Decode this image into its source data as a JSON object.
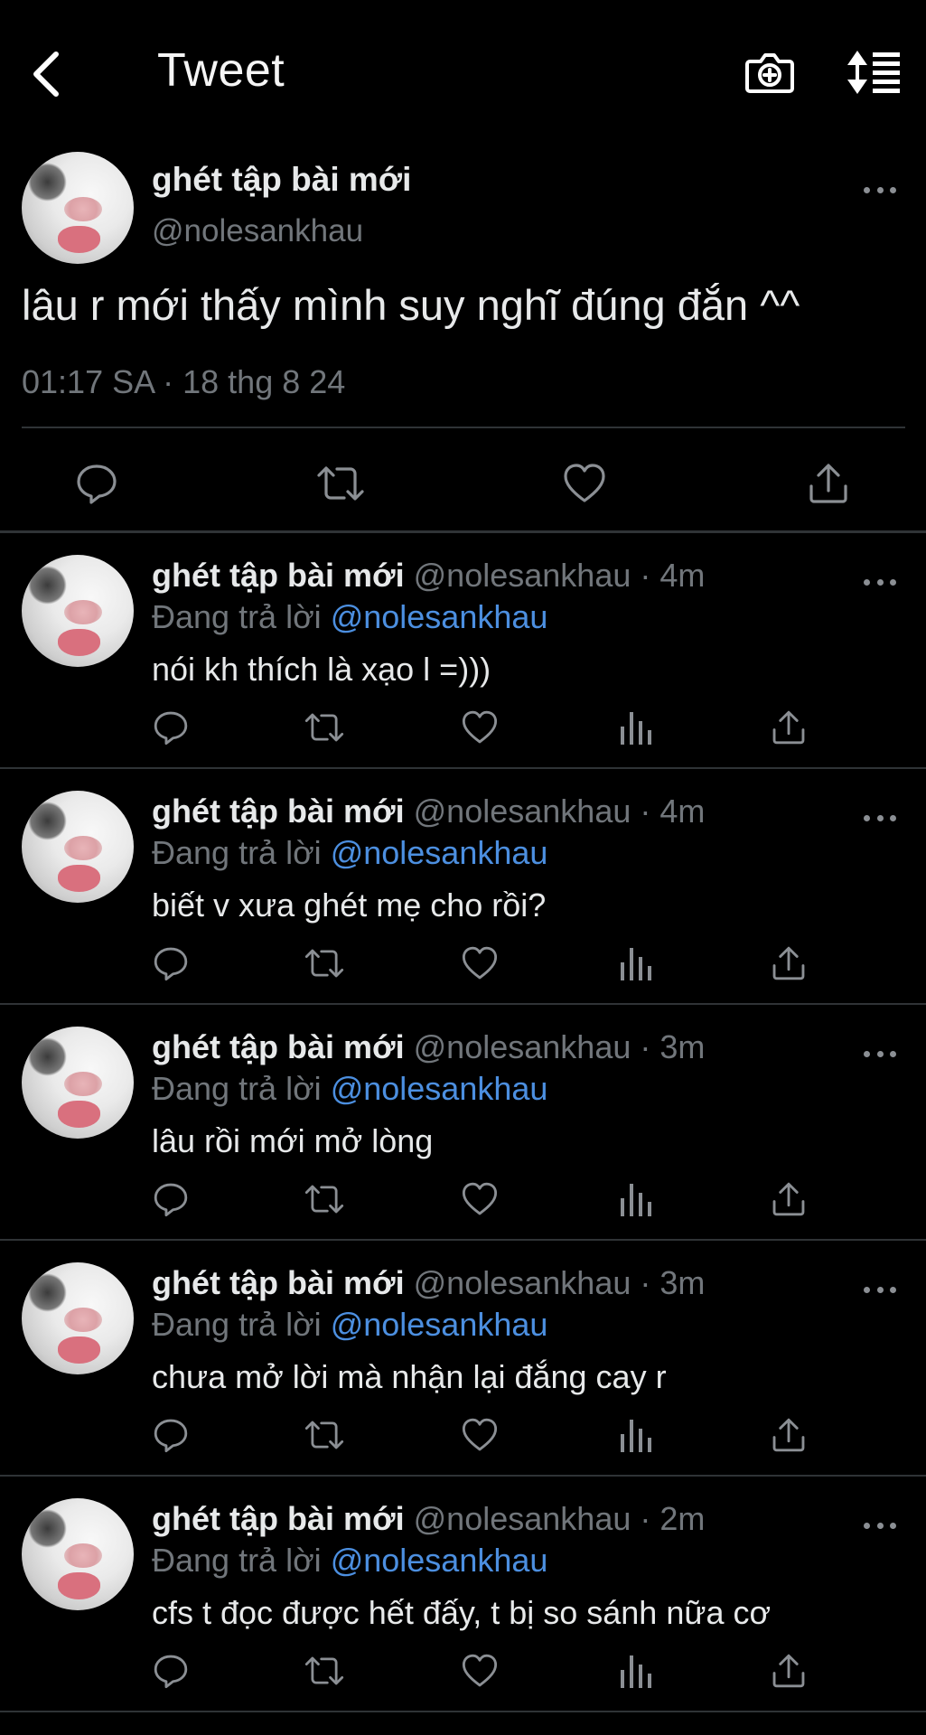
{
  "header": {
    "title": "Tweet",
    "back_icon": "chevron-left-icon",
    "camera_icon": "camera-add-icon",
    "sort_icon": "sort-list-icon"
  },
  "main_tweet": {
    "name": "ghét tập bài mới",
    "handle": "@nolesankhau",
    "text": "lâu r mới thấy mình suy nghĩ đúng đắn ^^",
    "meta": "01:17 SA · 18 thg 8 24",
    "actions": [
      "reply-icon",
      "retweet-icon",
      "like-icon",
      "share-icon"
    ]
  },
  "replies": [
    {
      "name": "ghét tập bài mới",
      "handle_time": "@nolesankhau · 4m",
      "replying_prefix": "Đang trả lời ",
      "replying_to": "@nolesankhau",
      "text": "nói kh thích là xạo l =)))"
    },
    {
      "name": "ghét tập bài mới",
      "handle_time": "@nolesankhau · 4m",
      "replying_prefix": "Đang trả lời ",
      "replying_to": "@nolesankhau",
      "text": "biết v xưa ghét mẹ cho rồi?"
    },
    {
      "name": "ghét tập bài mới",
      "handle_time": "@nolesankhau · 3m",
      "replying_prefix": "Đang trả lời ",
      "replying_to": "@nolesankhau",
      "text": "lâu rồi mới mở lòng"
    },
    {
      "name": "ghét tập bài mới",
      "handle_time": "@nolesankhau · 3m",
      "replying_prefix": "Đang trả lời ",
      "replying_to": "@nolesankhau",
      "text": "chưa mở lời mà nhận lại đắng cay r"
    },
    {
      "name": "ghét tập bài mới",
      "handle_time": "@nolesankhau · 2m",
      "replying_prefix": "Đang trả lời ",
      "replying_to": "@nolesankhau",
      "text": "cfs t đọc được hết đấy, t bị so sánh nữa cơ"
    }
  ],
  "colors": {
    "background": "#000000",
    "text": "#e7e9ea",
    "muted": "#71767b",
    "mention": "#4c8fe0",
    "divider": "#2f3336"
  }
}
